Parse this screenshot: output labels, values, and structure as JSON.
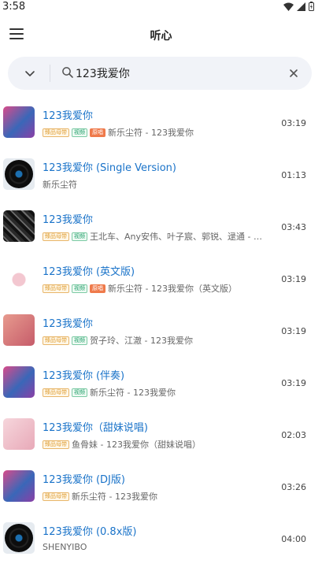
{
  "status": {
    "time": "3:58"
  },
  "app": {
    "title": "听心"
  },
  "search": {
    "value": "123我爱你"
  },
  "icons": {
    "menu": "hamburger-menu-icon",
    "chevron": "chevron-down-icon",
    "search": "search-icon",
    "clear": "close-icon"
  },
  "songs": [
    {
      "title": "123我爱你",
      "tags": [
        "臻品母带",
        "视频",
        "原唱"
      ],
      "artist": "新乐尘符 - 123我爱你",
      "duration": "03:19",
      "cover": "pink-art"
    },
    {
      "title": "123我爱你 (Single Version)",
      "tags": [],
      "artist": "新乐尘符",
      "duration": "01:13",
      "cover": "vinyl"
    },
    {
      "title": "123我爱你",
      "tags": [
        "臻品母带",
        "视频"
      ],
      "artist": "王北车、Any安伟、叶子宸、郭锐、逯通 - 乐...",
      "duration": "03:43",
      "cover": "dark-art"
    },
    {
      "title": "123我爱你 (英文版)",
      "tags": [
        "臻品母带",
        "视频",
        "原唱"
      ],
      "artist": "新乐尘符 - 123我爱你（英文版）",
      "duration": "03:19",
      "cover": "white-art"
    },
    {
      "title": "123我爱你",
      "tags": [
        "臻品母带",
        "视频"
      ],
      "artist": "贺子玲、江澈 - 123我爱你",
      "duration": "03:19",
      "cover": "rose-art"
    },
    {
      "title": "123我爱你 (伴奏)",
      "tags": [
        "臻品母带",
        "视频"
      ],
      "artist": "新乐尘符 - 123我爱你",
      "duration": "03:19",
      "cover": "pink-art"
    },
    {
      "title": "123我爱你（甜妹说唱)",
      "tags": [
        "臻品母带"
      ],
      "artist": "鱼骨妹 - 123我爱你（甜妹说唱）",
      "duration": "02:03",
      "cover": "light-pink-art"
    },
    {
      "title": "123我爱你 (DJ版)",
      "tags": [
        "臻品母带"
      ],
      "artist": "新乐尘符 - 123我爱你",
      "duration": "03:26",
      "cover": "pink-art"
    },
    {
      "title": "123我爱你 (0.8x版)",
      "tags": [],
      "artist": "SHENYIBO",
      "duration": "04:00",
      "cover": "vinyl"
    }
  ]
}
